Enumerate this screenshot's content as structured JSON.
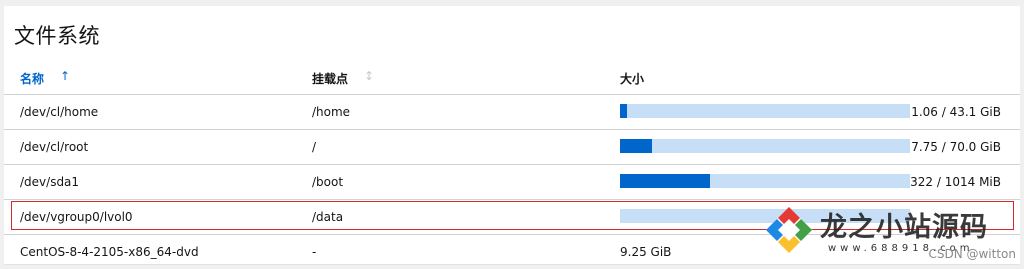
{
  "card": {
    "title": "文件系统"
  },
  "columns": {
    "name": "名称",
    "mount": "挂载点",
    "size": "大小"
  },
  "rows": [
    {
      "name": "/dev/cl/home",
      "mount": "/home",
      "size_text": "1.06 / 43.1 GiB",
      "usage_fraction": 0.025
    },
    {
      "name": "/dev/cl/root",
      "mount": "/",
      "size_text": "7.75 / 70.0 GiB",
      "usage_fraction": 0.11
    },
    {
      "name": "/dev/sda1",
      "mount": "/boot",
      "size_text": "322 / 1014 MiB",
      "usage_fraction": 0.31
    },
    {
      "name": "/dev/vgroup0/lvol0",
      "mount": "/data",
      "size_text": "",
      "usage_fraction": 0.0
    },
    {
      "name": "CentOS-8-4-2105-x86_64-dvd",
      "mount": "-",
      "size_text": "9.25 GiB"
    }
  ],
  "watermark": {
    "brand": "龙之小站源码",
    "url": "www.688918.com",
    "credit": "CSDN @witton"
  },
  "colors": {
    "accent": "#0066cc",
    "bar_track": "#c7dff6",
    "highlight_border": "#d62a2a"
  },
  "icons": {
    "sort_active": "sort-ascending-icon",
    "sort_inactive": "sort-neutral-icon"
  }
}
